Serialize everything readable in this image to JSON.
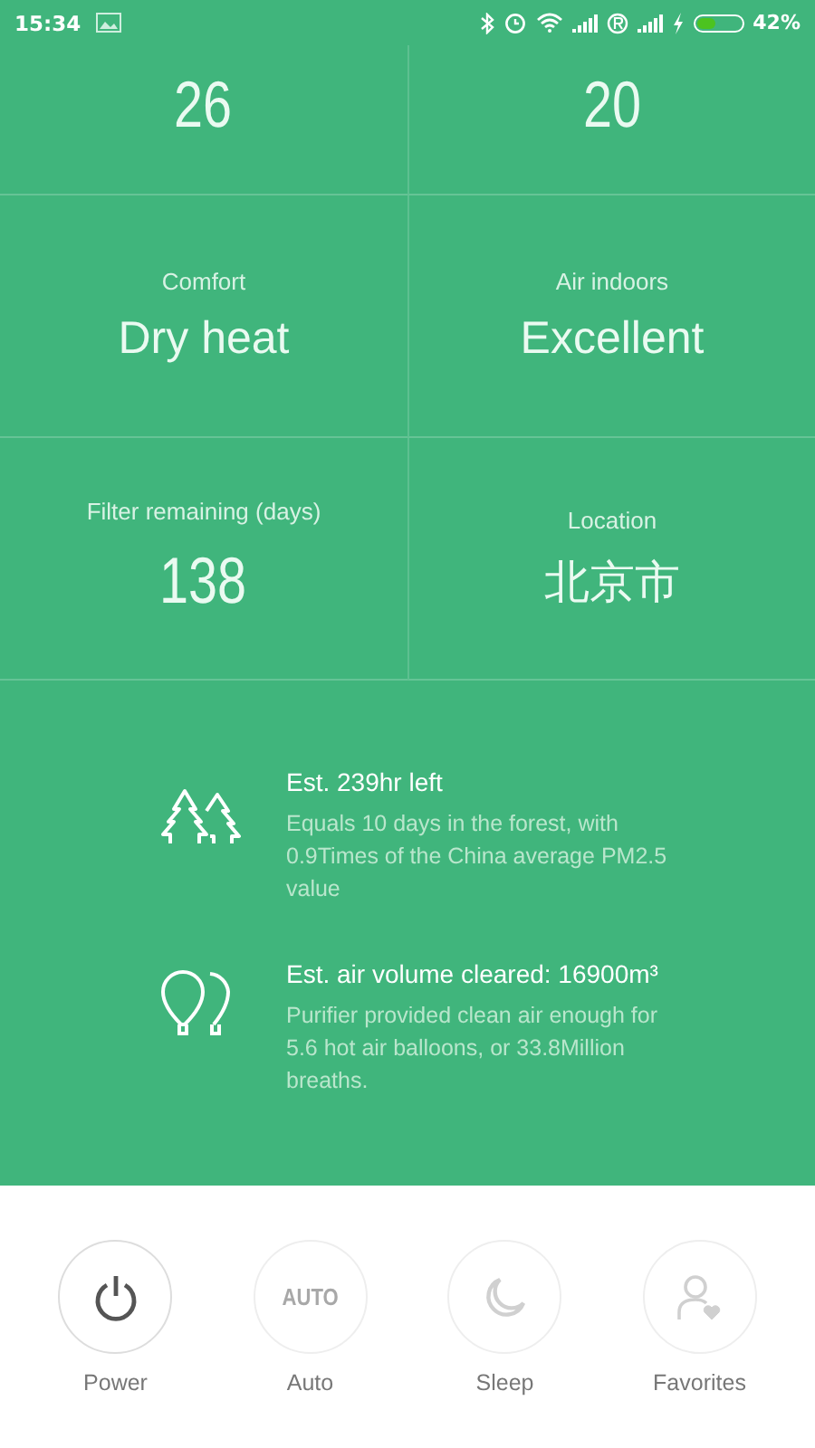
{
  "status_bar": {
    "time": "15:34",
    "battery": {
      "level": 0.42,
      "charging": true
    },
    "battery_text": "42%"
  },
  "tiles": [
    {
      "value": "26"
    },
    {
      "value": "20"
    },
    {
      "label": "Comfort",
      "value": "Dry heat"
    },
    {
      "label": "Air indoors",
      "value": "Excellent"
    },
    {
      "label": "Filter remaining (days)",
      "value": "138"
    },
    {
      "label": "Location",
      "value": "北京市"
    }
  ],
  "info": [
    {
      "kind": "trees",
      "title": "Est. 239hr left",
      "text": "Equals 10 days in the forest, with 0.9Times of the China average PM2.5 value"
    },
    {
      "kind": "balloons",
      "title": "Est. air volume cleared: 16900m³",
      "text": "Purifier provided clean air enough for 5.6 hot air balloons, or 33.8Million breaths."
    }
  ],
  "controls": [
    {
      "kind": "power",
      "label": "Power",
      "disabled": false
    },
    {
      "kind": "auto",
      "icon_text": "AUTO",
      "label": "Auto",
      "disabled": true
    },
    {
      "kind": "sleep",
      "label": "Sleep",
      "disabled": true
    },
    {
      "kind": "favorites",
      "label": "Favorites",
      "disabled": true
    }
  ]
}
